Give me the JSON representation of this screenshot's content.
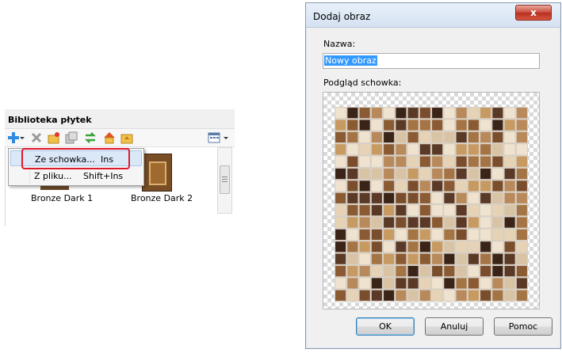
{
  "library": {
    "title": "Biblioteka płytek",
    "tiles": [
      {
        "label": "Bronze Dark 1"
      },
      {
        "label": "Bronze Dark 2"
      }
    ]
  },
  "context_menu": {
    "items": [
      {
        "label": "Ze schowka...",
        "shortcut": "Ins"
      },
      {
        "label": "Z pliku...",
        "shortcut": "Shift+Ins"
      }
    ]
  },
  "dialog": {
    "title": "Dodaj obraz",
    "close_glyph": "x",
    "name_label": "Nazwa:",
    "name_value": "Nowy obraz",
    "preview_label": "Podgląd schowka:",
    "buttons": {
      "ok": "OK",
      "cancel": "Anuluj",
      "help": "Pomoc"
    }
  },
  "colors": {
    "highlight_border": "#e0182c",
    "selection": "#3399ff",
    "tile_palette": [
      "#5a3a26",
      "#8a5a32",
      "#b8895a",
      "#d9c3a5",
      "#efe3cf",
      "#3a2418",
      "#c79a62",
      "#e6d3b6",
      "#7a4e2c",
      "#a47444"
    ]
  }
}
